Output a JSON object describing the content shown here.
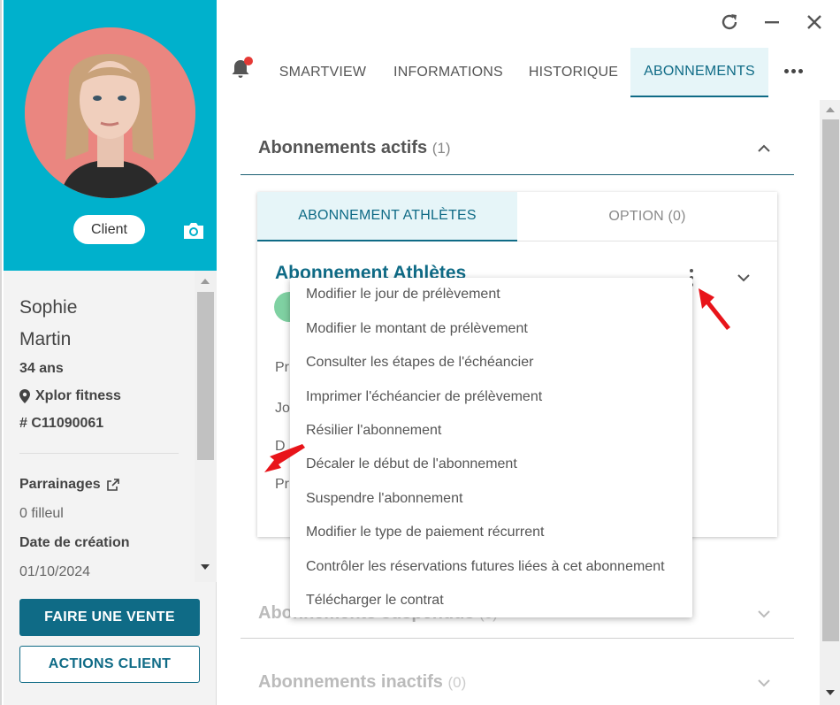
{
  "window": {
    "controls": {
      "refresh": "refresh",
      "minimize": "minimize",
      "close": "close"
    }
  },
  "client": {
    "badge": "Client",
    "first_name": "Sophie",
    "last_name": "Martin",
    "age": "34 ans",
    "location": "Xplor fitness",
    "id": "# C11090061",
    "sponsorships_label": "Parrainages",
    "sponsorships_value": "0 filleul",
    "creation_label": "Date de création",
    "creation_value": "01/10/2024"
  },
  "buttons": {
    "sale": "FAIRE UNE VENTE",
    "actions": "ACTIONS CLIENT"
  },
  "tabs": [
    {
      "label": "SMARTVIEW",
      "active": false
    },
    {
      "label": "INFORMATIONS",
      "active": false
    },
    {
      "label": "HISTORIQUE",
      "active": false
    },
    {
      "label": "ABONNEMENTS",
      "active": true
    }
  ],
  "sections": {
    "active": {
      "title": "Abonnements actifs",
      "count": "(1)"
    },
    "suspended": {
      "title": "Abonnements suspendus",
      "count": "(0)"
    },
    "inactive": {
      "title": "Abonnements inactifs",
      "count": "(0)"
    }
  },
  "card": {
    "tab1": "ABONNEMENT ATHLÈTES",
    "tab2": "OPTION (0)",
    "title": "Abonnement Athlètes",
    "cut_rows": [
      "Pr",
      "Jo",
      "D",
      "Pr"
    ]
  },
  "menu": {
    "items": [
      "Modifier le jour de prélèvement",
      "Modifier le montant de prélèvement",
      "Consulter les étapes de l'échéancier",
      "Imprimer l'échéancier de prélèvement",
      "Résilier l'abonnement",
      "Décaler le début de l'abonnement",
      "Suspendre l'abonnement",
      "Modifier le type de paiement récurrent",
      "Contrôler les réservations futures liées à cet abonnement",
      "Télécharger le contrat"
    ]
  },
  "colors": {
    "hero": "#00b1cc",
    "primary": "#0f6b86",
    "active_tab_bg": "#e6f5f8",
    "notification": "#e53935",
    "annotation_arrow": "#e8141a"
  }
}
